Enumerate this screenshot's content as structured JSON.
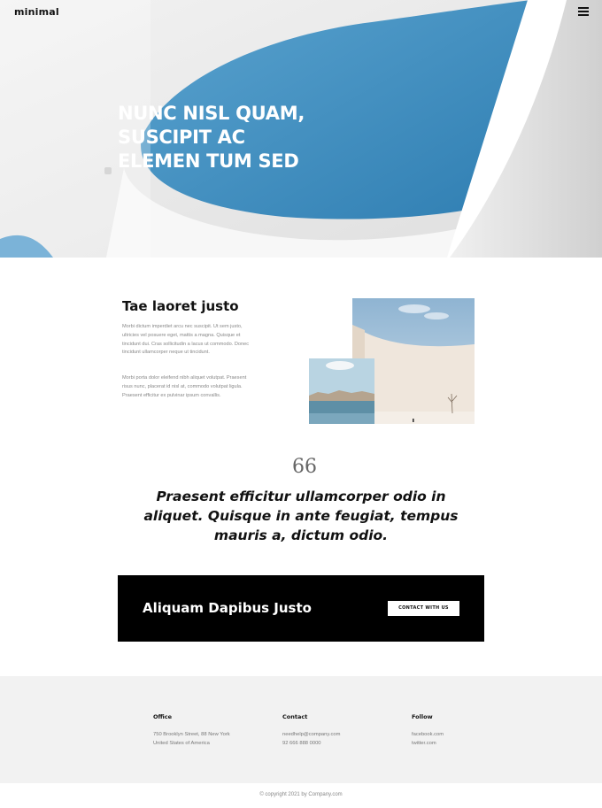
{
  "header": {
    "logo": "minimal",
    "menu_icon": "hamburger-menu-icon"
  },
  "hero": {
    "title_line1": "NUNC NISL QUAM,",
    "title_line2": "SUSCIPIT AC",
    "title_line3": "ELEMEN TUM SED",
    "sky_color": "#3a8dc0",
    "wall_color": "#e6e6e6"
  },
  "about": {
    "title": "Tae laoret justo",
    "paragraph1": "Morbi dictum imperdiet arcu nec suscipit. Ut sem justo, ultricies vel posuere eget, mattis a magna. Quisque et tincidunt dui. Cras sollicitudin a lacus ut commodo. Donec tincidunt ullamcorper neque ut tincidunt.",
    "paragraph2": "Morbi porta dolor eleifend nibh aliquet volutpat. Praesent risus nunc, placerat id nisl at, commodo volutpat ligula. Praesent efficitur ex pulvinar ipsum convallis."
  },
  "quote": {
    "icon": "quote-icon",
    "mark": "66",
    "text": "Praesent efficitur ullamcorper odio in aliquet. Quisque in ante feugiat, tempus mauris a, dictum odio."
  },
  "cta": {
    "title": "Aliquam Dapibus Justo",
    "button_label": "CONTACT WITH US"
  },
  "footer": {
    "office": {
      "heading": "Office",
      "line1": "750 Brooklyn Street, 88 New York",
      "line2": "United States of America"
    },
    "contact": {
      "heading": "Contact",
      "line1": "needhelp@company.com",
      "line2": "92 666 888 0000"
    },
    "follow": {
      "heading": "Follow",
      "line1": "facebook.com",
      "line2": "twitter.com"
    },
    "copyright": "© copyright 2021 by Company.com"
  }
}
